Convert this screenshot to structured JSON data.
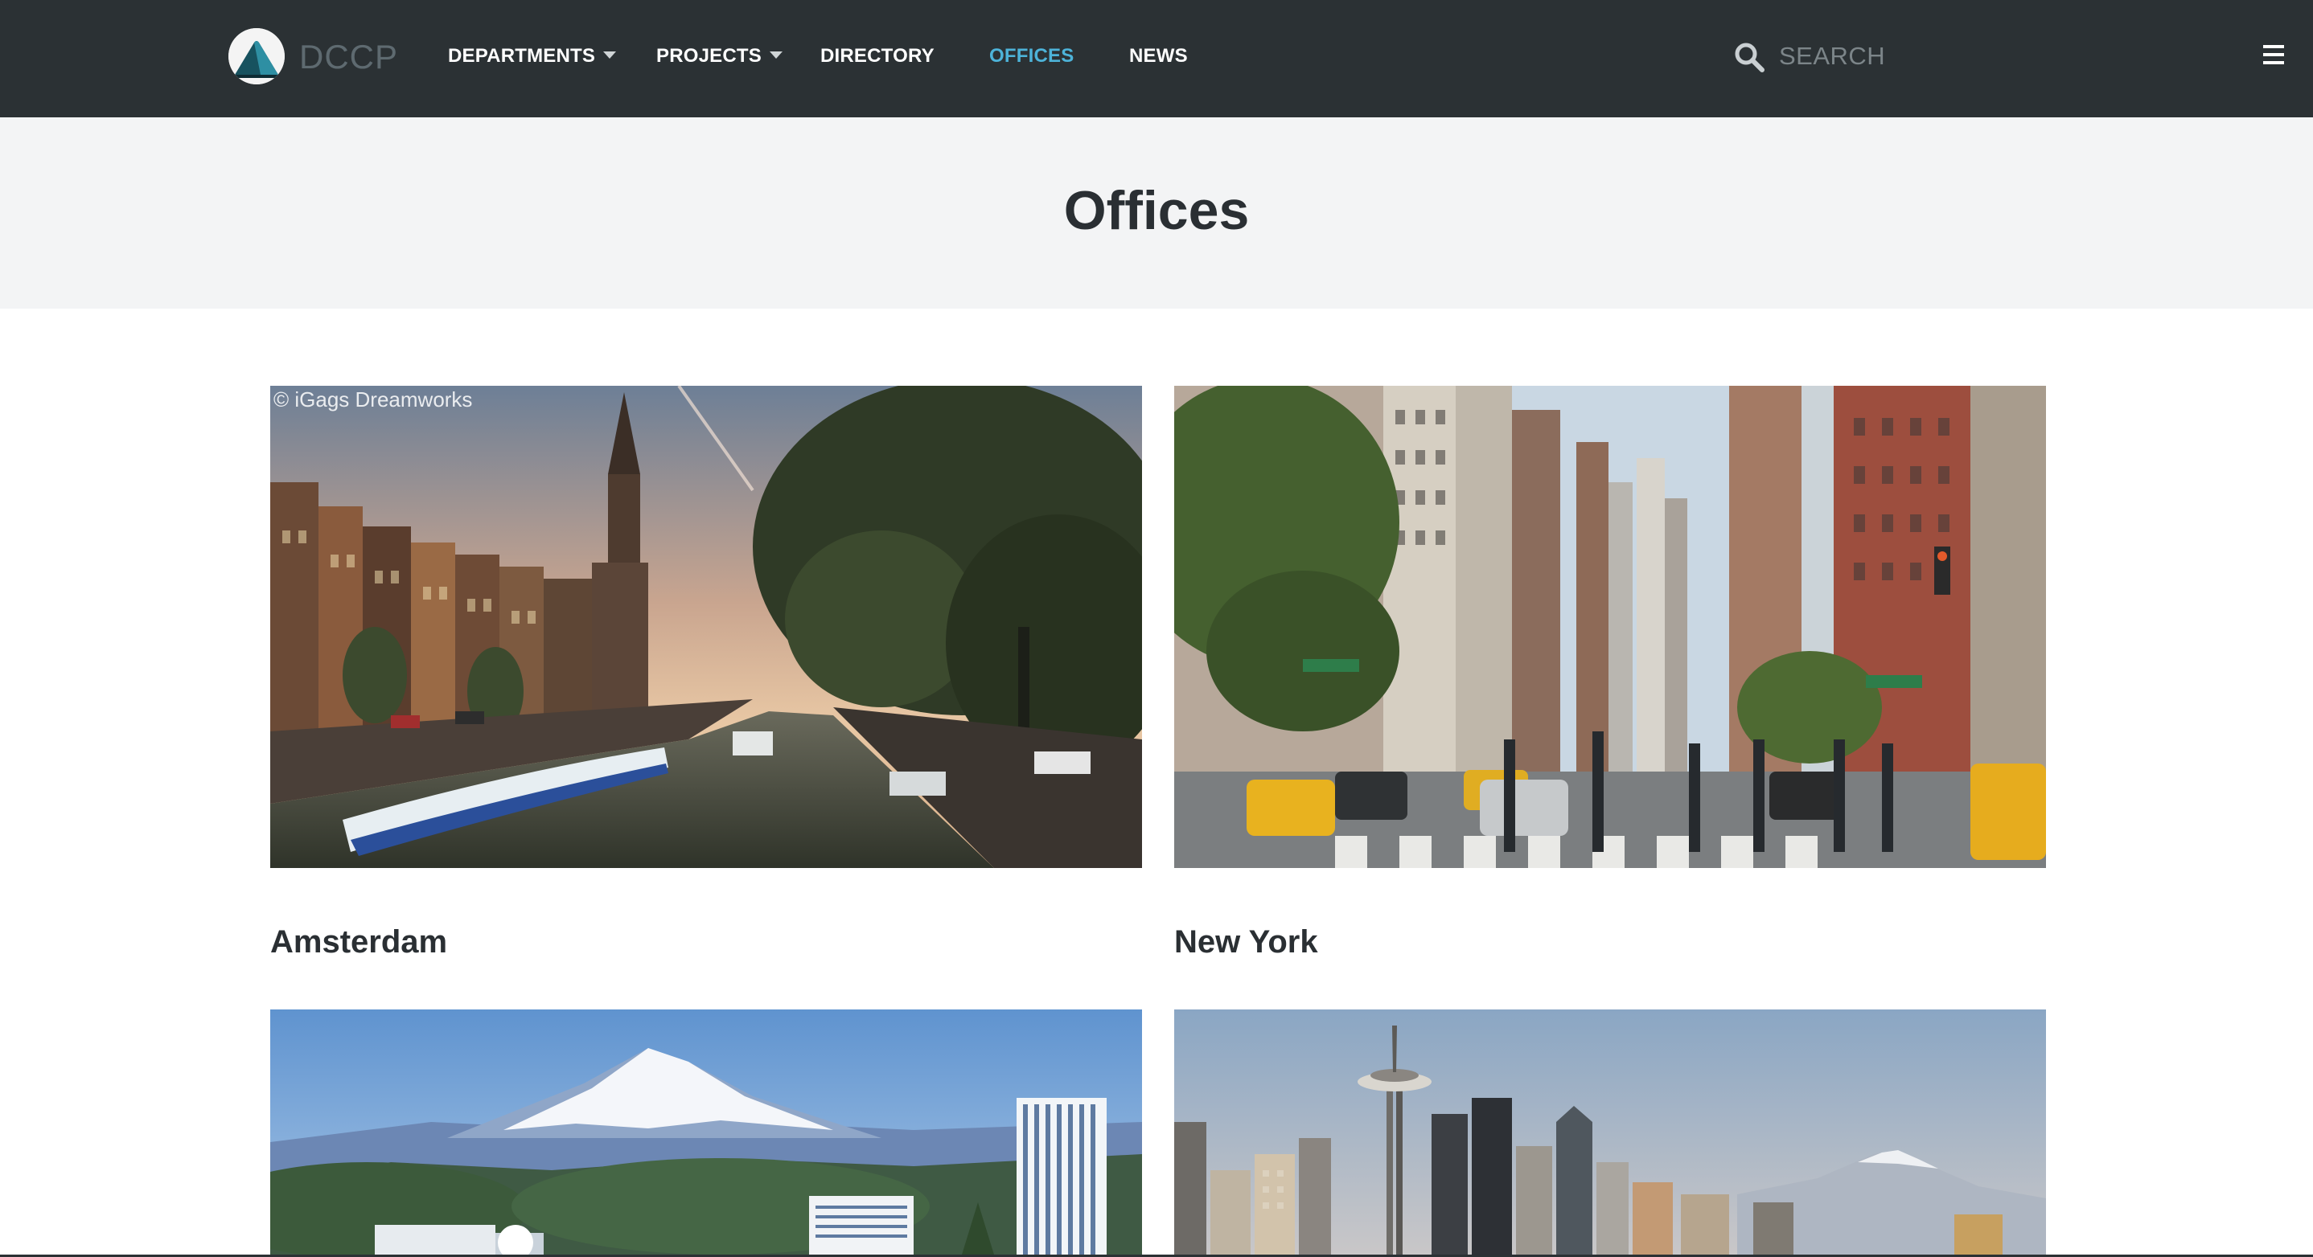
{
  "nav": {
    "brand": "DCCP",
    "items": [
      {
        "label": "DEPARTMENTS",
        "dropdown": true,
        "active": false
      },
      {
        "label": "PROJECTS",
        "dropdown": true,
        "active": false
      },
      {
        "label": "DIRECTORY",
        "dropdown": false,
        "active": false
      },
      {
        "label": "OFFICES",
        "dropdown": false,
        "active": true
      },
      {
        "label": "NEWS",
        "dropdown": false,
        "active": false
      }
    ],
    "search_placeholder": "SEARCH",
    "active_color": "#4db3d9",
    "background": "#2b3134"
  },
  "header": {
    "title": "Offices"
  },
  "offices": [
    {
      "city": "Amsterdam",
      "credit": "© iGags Dreamworks",
      "image": "amsterdam-canal-photo"
    },
    {
      "city": "New York",
      "credit": "",
      "image": "new-york-street-photo"
    },
    {
      "city": "",
      "image": "portland-mount-hood-photo"
    },
    {
      "city": "",
      "image": "seattle-skyline-photo"
    }
  ],
  "icons": {
    "logo": "mountain-logo-icon",
    "search": "search-icon",
    "menu": "hamburger-menu-icon"
  }
}
